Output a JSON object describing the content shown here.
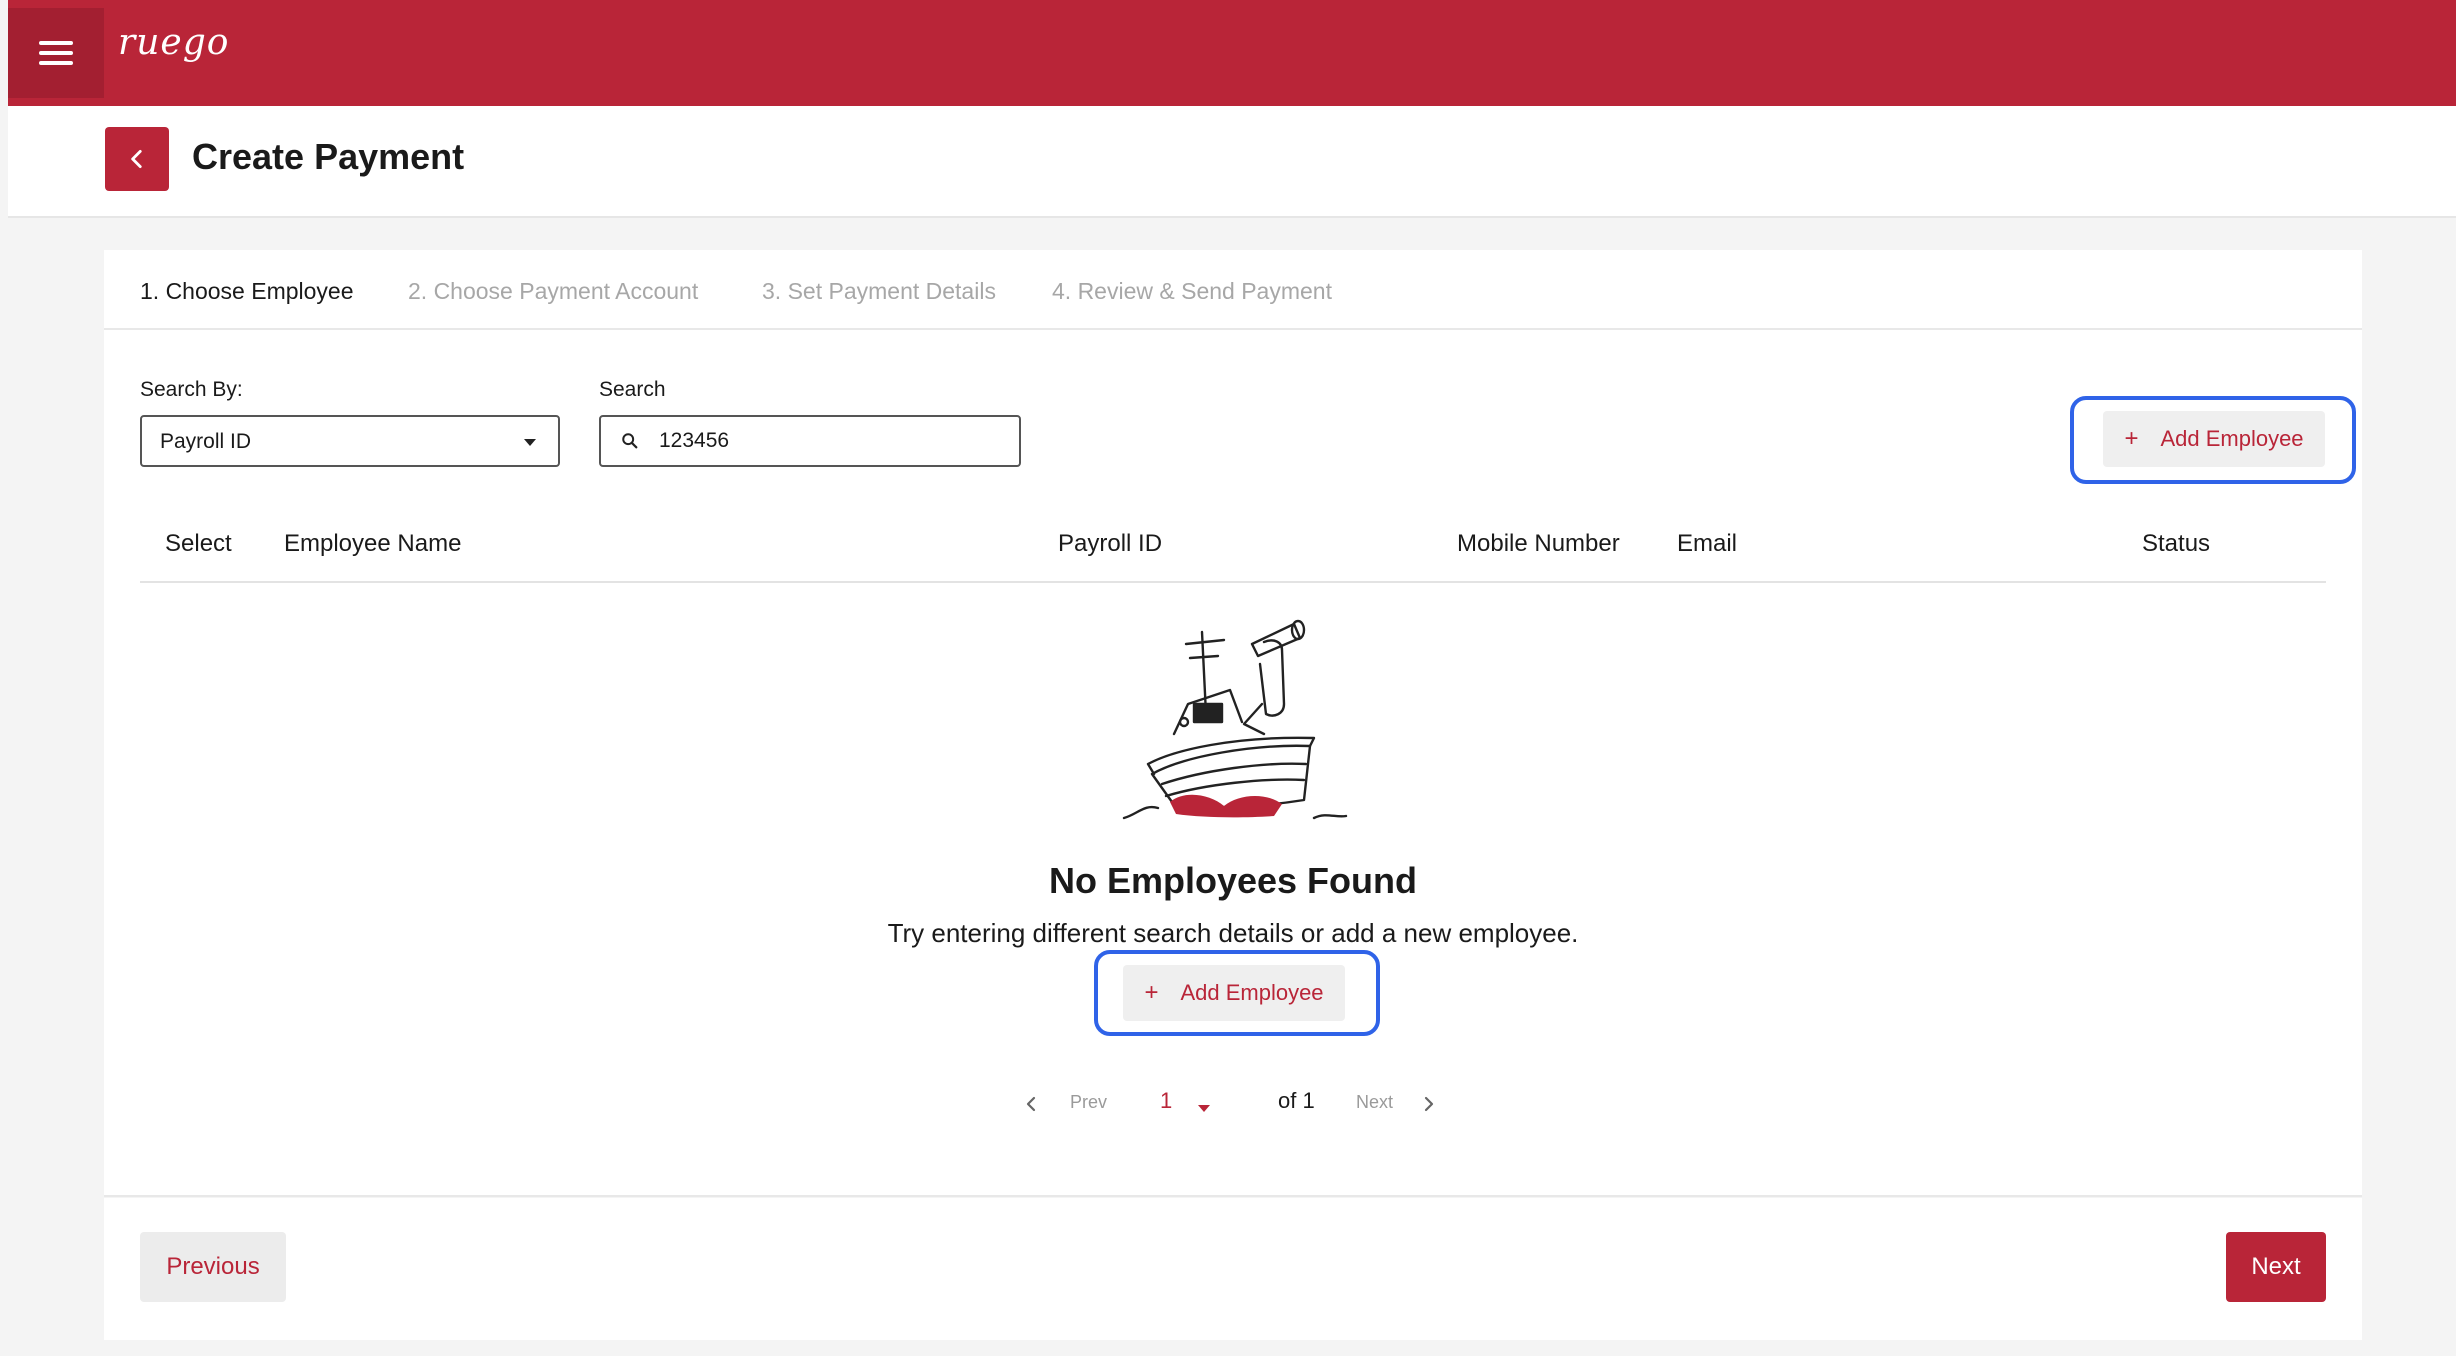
{
  "app": {
    "logo": "ruego"
  },
  "header": {
    "title": "Create Payment"
  },
  "steps": [
    {
      "label": "1. Choose Employee",
      "active": true
    },
    {
      "label": "2. Choose Payment Account",
      "active": false
    },
    {
      "label": "3. Set Payment Details",
      "active": false
    },
    {
      "label": "4. Review & Send Payment",
      "active": false
    }
  ],
  "search": {
    "by_label": "Search By:",
    "by_value": "Payroll ID",
    "label": "Search",
    "value": "123456"
  },
  "add_employee_label": "Add Employee",
  "table": {
    "columns": [
      "Select",
      "Employee Name",
      "Payroll ID",
      "Mobile Number",
      "Email",
      "Status"
    ]
  },
  "empty": {
    "title": "No Employees Found",
    "subtitle": "Try entering different search details or add a new employee."
  },
  "pagination": {
    "prev": "Prev",
    "page": "1",
    "of": "of 1",
    "next": "Next"
  },
  "footer": {
    "previous": "Previous",
    "next": "Next"
  },
  "colors": {
    "brand": "#b92538",
    "highlight": "#2f63e8"
  }
}
